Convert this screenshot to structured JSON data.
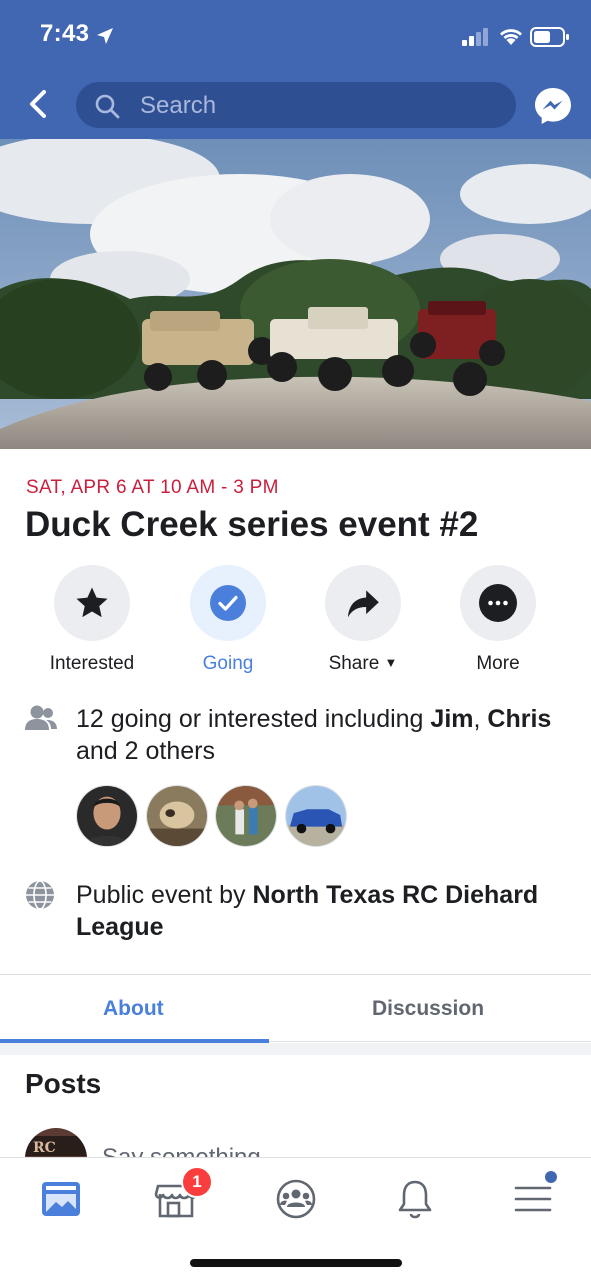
{
  "status_bar": {
    "time": "7:43"
  },
  "header": {
    "search_placeholder": "Search"
  },
  "event": {
    "date": "SAT, APR 6 AT 10 AM - 3 PM",
    "title": "Duck Creek series event #2"
  },
  "actions": [
    {
      "label": "Interested",
      "icon": "star-icon"
    },
    {
      "label": "Going",
      "icon": "check-icon"
    },
    {
      "label": "Share",
      "icon": "share-arrow-icon"
    },
    {
      "label": "More",
      "icon": "more-dots-icon"
    }
  ],
  "attendance": {
    "prefix": "12 going or interested including ",
    "name1": "Jim",
    "sep1": ", ",
    "name2": "Chris",
    "suffix": " and 2 others"
  },
  "host": {
    "prefix": "Public event by ",
    "name": "North Texas RC Diehard League"
  },
  "tabs": {
    "about": "About",
    "discussion": "Discussion"
  },
  "posts": {
    "heading": "Posts",
    "composer_placeholder": "Say something..."
  },
  "bottom_nav": {
    "marketplace_badge": "1"
  },
  "colors": {
    "header_blue": "#4267b2",
    "accent_blue": "#4a80dc",
    "date_red": "#c9203e",
    "badge_red": "#fa3e3e"
  }
}
